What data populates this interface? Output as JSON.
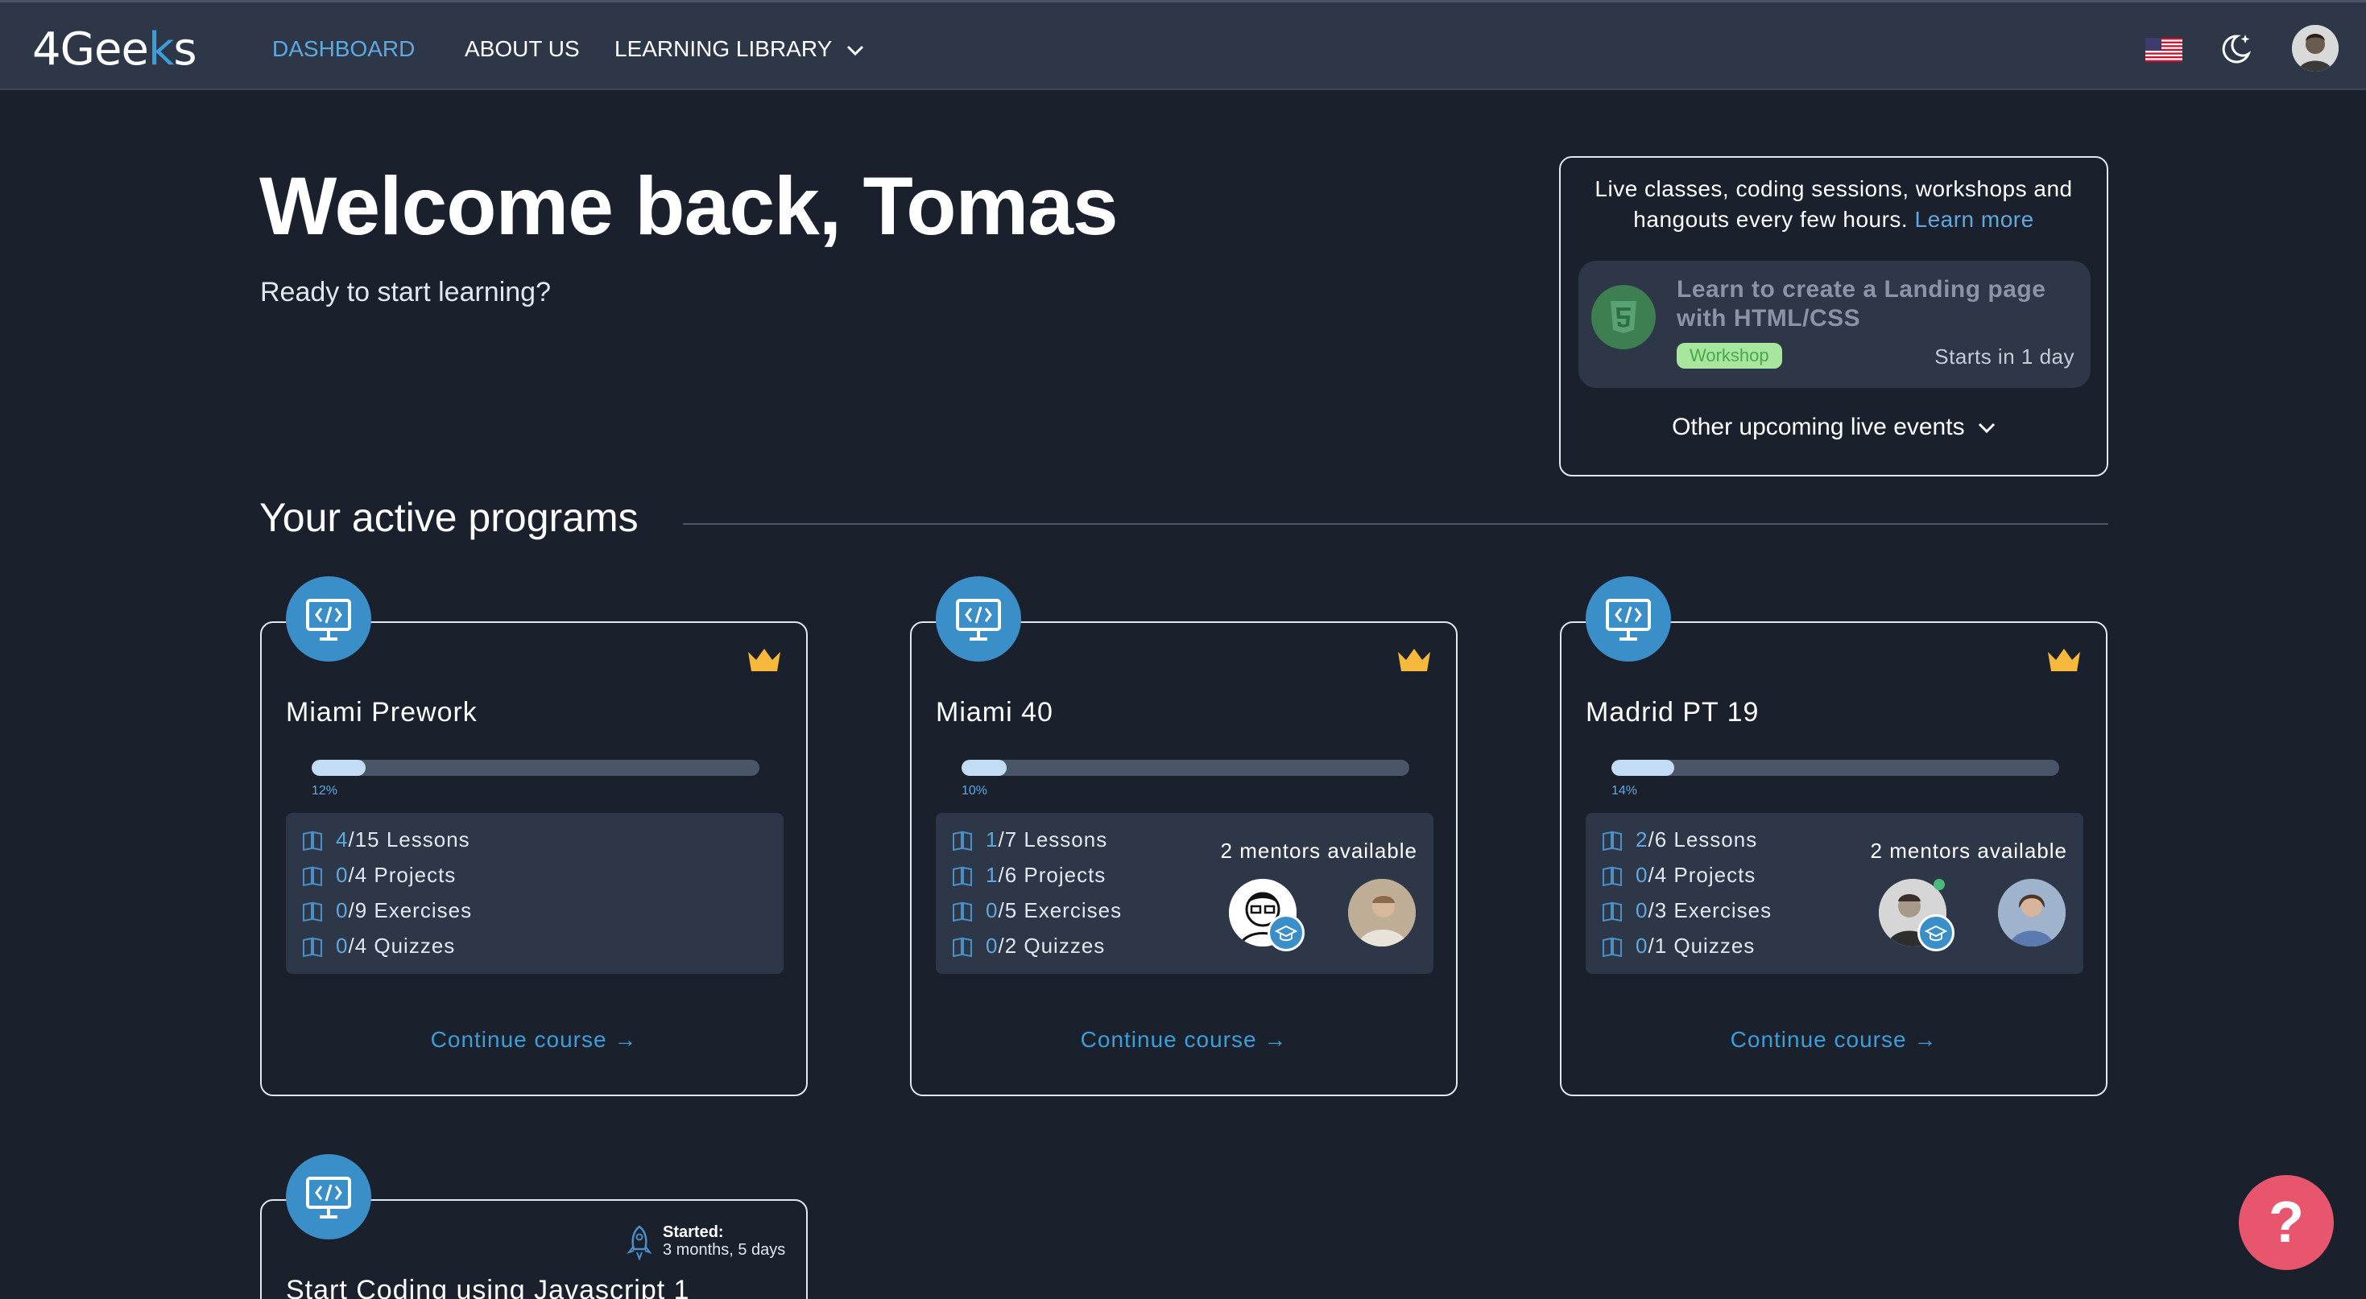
{
  "nav": {
    "logo_text": "4Gee",
    "logo_accent": "k",
    "logo_tail": "s",
    "links": [
      {
        "label": "DASHBOARD",
        "active": true
      },
      {
        "label": "ABOUT US",
        "active": false
      },
      {
        "label": "LEARNING LIBRARY",
        "active": false,
        "dropdown": true
      }
    ],
    "icons": [
      "us-flag-icon",
      "dark-mode-moon-icon",
      "user-avatar"
    ]
  },
  "hero": {
    "title": "Welcome back, Tomas",
    "subtitle": "Ready to start learning?"
  },
  "live_events": {
    "intro": "Live classes, coding sessions, workshops and hangouts every few hours.",
    "learn_more": "Learn more",
    "event": {
      "title": "Learn to create a Landing page with HTML/CSS",
      "tag": "Workshop",
      "starts": "Starts in 1 day",
      "icon": "html5-icon"
    },
    "other_label": "Other upcoming live events"
  },
  "section": {
    "title": "Your active programs"
  },
  "programs": [
    {
      "title": "Miami Prework",
      "progress_percent": 12,
      "progress_label": "12%",
      "stats": [
        {
          "done": "4",
          "total": "/15 Lessons"
        },
        {
          "done": "0",
          "total": "/4 Projects"
        },
        {
          "done": "0",
          "total": "/9 Exercises"
        },
        {
          "done": "0",
          "total": "/4 Quizzes"
        }
      ],
      "mentors_label": "",
      "continue_label": "Continue course →"
    },
    {
      "title": "Miami 40",
      "progress_percent": 10,
      "progress_label": "10%",
      "stats": [
        {
          "done": "1",
          "total": "/7 Lessons"
        },
        {
          "done": "1",
          "total": "/6 Projects"
        },
        {
          "done": "0",
          "total": "/5 Exercises"
        },
        {
          "done": "0",
          "total": "/2 Quizzes"
        }
      ],
      "mentors_label": "2 mentors available",
      "continue_label": "Continue course →"
    },
    {
      "title": "Madrid PT 19",
      "progress_percent": 14,
      "progress_label": "14%",
      "stats": [
        {
          "done": "2",
          "total": "/6 Lessons"
        },
        {
          "done": "0",
          "total": "/4 Projects"
        },
        {
          "done": "0",
          "total": "/3 Exercises"
        },
        {
          "done": "0",
          "total": "/1 Quizzes"
        }
      ],
      "mentors_label": "2 mentors available",
      "continue_label": "Continue course →"
    },
    {
      "title": "Start Coding using Javascript 1",
      "started_label": "Started:",
      "started_value": "3 months, 5 days"
    }
  ],
  "help": {
    "label": "?"
  },
  "colors": {
    "background": "#1a202c",
    "navbar": "#2d3748",
    "accent": "#3b9ed8",
    "premium_crown": "#f6b93b",
    "help_button": "#e8566e"
  }
}
